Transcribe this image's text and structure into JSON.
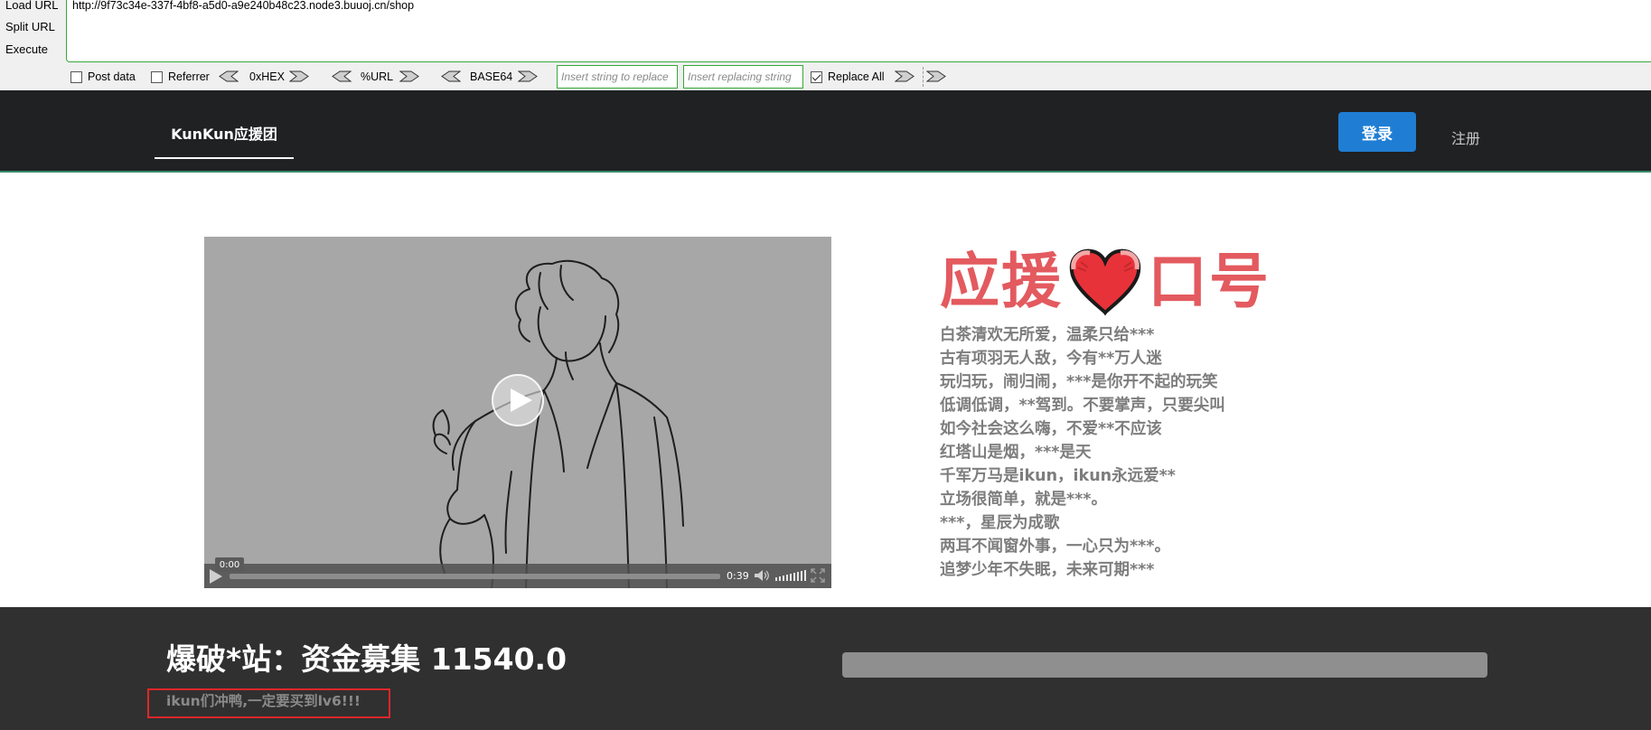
{
  "hackbar": {
    "side_menu": [
      "Load URL",
      "Split URL",
      "Execute"
    ],
    "url": "http://9f73c34e-337f-4bf8-a5d0-a9e240b48c23.node3.buuoj.cn/shop",
    "post_data_label": "Post data",
    "post_data_checked": false,
    "referrer_label": "Referrer",
    "referrer_checked": false,
    "encoders": [
      "0xHEX",
      "%URL",
      "BASE64"
    ],
    "replace_find_placeholder": "Insert string to replace",
    "replace_with_placeholder": "Insert replacing string",
    "replace_all_label": "Replace All",
    "replace_all_checked": true
  },
  "navbar": {
    "brand": "KunKun应援团",
    "login_label": "登录",
    "register_label": "注册"
  },
  "video": {
    "current_time": "0:00",
    "duration": "0:39",
    "progress": 0
  },
  "slogan": {
    "title_left": "应援",
    "title_icon": "heart-icon",
    "title_right": "口号",
    "lines": [
      "白茶清欢无所爱，温柔只给***",
      "古有项羽无人敌，今有**万人迷",
      "玩归玩，闹归闹，***是你开不起的玩笑",
      "低调低调，**驾到。不要掌声，只要尖叫",
      "如今社会这么嗨，不爱**不应该",
      "红塔山是烟，***是天",
      "千军万马是ikun，ikun永远爱**",
      "立场很简单，就是***。",
      "***，星辰为成歌",
      "两耳不闻窗外事，一心只为***。",
      "追梦少年不失眠，未来可期***"
    ]
  },
  "funding": {
    "title": "爆破*站：资金募集 11540.0",
    "hint": "ikun们冲鸭,一定要买到lv6!!!",
    "progress": 0
  },
  "colors": {
    "accent_green": "#38a838",
    "navbar_bg": "#1f2123",
    "login_blue": "#1f7ed4",
    "slogan_red": "#e35a5f",
    "highlight_red": "#e0262a",
    "bottom_bg": "#303030"
  }
}
